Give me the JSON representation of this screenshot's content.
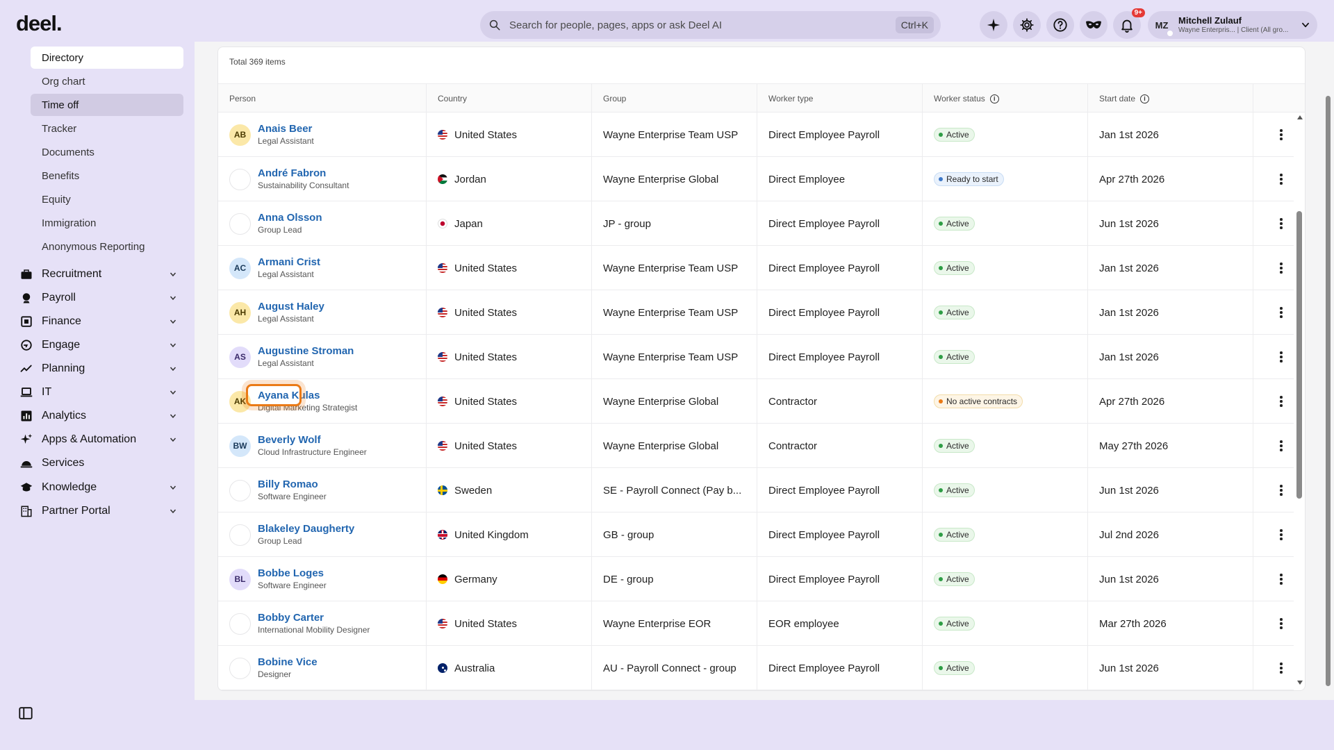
{
  "app": {
    "logo": "deel."
  },
  "search": {
    "placeholder": "Search for people, pages, apps or ask Deel AI",
    "shortcut": "Ctrl+K"
  },
  "notifications": {
    "badge": "9+"
  },
  "user": {
    "initials": "MZ",
    "name": "Mitchell Zulauf",
    "subtitle": "Wayne Enterpris... | Client (All gro..."
  },
  "sidebar": {
    "sub_items": [
      "Directory",
      "Org chart",
      "Time off",
      "Tracker",
      "Documents",
      "Benefits",
      "Equity",
      "Immigration",
      "Anonymous Reporting"
    ],
    "sections": [
      {
        "label": "Recruitment",
        "icon": "briefcase-icon",
        "expandable": true
      },
      {
        "label": "Payroll",
        "icon": "payroll-icon",
        "expandable": true
      },
      {
        "label": "Finance",
        "icon": "finance-icon",
        "expandable": true
      },
      {
        "label": "Engage",
        "icon": "engage-icon",
        "expandable": true
      },
      {
        "label": "Planning",
        "icon": "trend-icon",
        "expandable": true
      },
      {
        "label": "IT",
        "icon": "laptop-icon",
        "expandable": true
      },
      {
        "label": "Analytics",
        "icon": "chart-icon",
        "expandable": true
      },
      {
        "label": "Apps & Automation",
        "icon": "sparkle-icon",
        "expandable": true
      },
      {
        "label": "Services",
        "icon": "cloche-icon",
        "expandable": false
      },
      {
        "label": "Knowledge",
        "icon": "graduation-cap-icon",
        "expandable": true
      },
      {
        "label": "Partner Portal",
        "icon": "building-icon",
        "expandable": true
      }
    ]
  },
  "table": {
    "total": "Total 369 items",
    "columns": [
      "Person",
      "Country",
      "Group",
      "Worker type",
      "Worker status",
      "Start date"
    ],
    "rows": [
      {
        "initials": "AB",
        "avatar": "yellow",
        "name": "Anais Beer",
        "role": "Legal Assistant",
        "flag": "us",
        "country": "United States",
        "group": "Wayne Enterprise Team USP",
        "worker_type": "Direct Employee Payroll",
        "status": "Active",
        "status_kind": "active",
        "start": "Jan 1st 2026"
      },
      {
        "initials": "",
        "avatar": "empty",
        "name": "André Fabron",
        "role": "Sustainability Consultant",
        "flag": "jo",
        "country": "Jordan",
        "group": "Wayne Enterprise Global",
        "worker_type": "Direct Employee",
        "status": "Ready to start",
        "status_kind": "ready",
        "start": "Apr 27th 2026"
      },
      {
        "initials": "",
        "avatar": "empty",
        "name": "Anna Olsson",
        "role": "Group Lead",
        "flag": "jp",
        "country": "Japan",
        "group": "JP - group",
        "worker_type": "Direct Employee Payroll",
        "status": "Active",
        "status_kind": "active",
        "start": "Jun 1st 2026"
      },
      {
        "initials": "AC",
        "avatar": "blue",
        "name": "Armani Crist",
        "role": "Legal Assistant",
        "flag": "us",
        "country": "United States",
        "group": "Wayne Enterprise Team USP",
        "worker_type": "Direct Employee Payroll",
        "status": "Active",
        "status_kind": "active",
        "start": "Jan 1st 2026"
      },
      {
        "initials": "AH",
        "avatar": "yellow",
        "name": "August Haley",
        "role": "Legal Assistant",
        "flag": "us",
        "country": "United States",
        "group": "Wayne Enterprise Team USP",
        "worker_type": "Direct Employee Payroll",
        "status": "Active",
        "status_kind": "active",
        "start": "Jan 1st 2026"
      },
      {
        "initials": "AS",
        "avatar": "purple",
        "name": "Augustine Stroman",
        "role": "Legal Assistant",
        "flag": "us",
        "country": "United States",
        "group": "Wayne Enterprise Team USP",
        "worker_type": "Direct Employee Payroll",
        "status": "Active",
        "status_kind": "active",
        "start": "Jan 1st 2026"
      },
      {
        "initials": "AK",
        "avatar": "yellow",
        "name": "Ayana Kulas",
        "role": "Digital Marketing Strategist",
        "flag": "us",
        "country": "United States",
        "group": "Wayne Enterprise Global",
        "worker_type": "Contractor",
        "status": "No active contracts",
        "status_kind": "none",
        "start": "Apr 27th 2026",
        "highlighted": true
      },
      {
        "initials": "BW",
        "avatar": "blue",
        "name": "Beverly Wolf",
        "role": "Cloud Infrastructure Engineer",
        "flag": "us",
        "country": "United States",
        "group": "Wayne Enterprise Global",
        "worker_type": "Contractor",
        "status": "Active",
        "status_kind": "active",
        "start": "May 27th 2026"
      },
      {
        "initials": "",
        "avatar": "empty",
        "name": "Billy Romao",
        "role": "Software Engineer",
        "flag": "se",
        "country": "Sweden",
        "group": "SE - Payroll Connect (Pay b...",
        "worker_type": "Direct Employee Payroll",
        "status": "Active",
        "status_kind": "active",
        "start": "Jun 1st 2026"
      },
      {
        "initials": "",
        "avatar": "empty",
        "name": "Blakeley Daugherty",
        "role": "Group Lead",
        "flag": "gb",
        "country": "United Kingdom",
        "group": "GB - group",
        "worker_type": "Direct Employee Payroll",
        "status": "Active",
        "status_kind": "active",
        "start": "Jul 2nd 2026"
      },
      {
        "initials": "BL",
        "avatar": "purple",
        "name": "Bobbe Loges",
        "role": "Software Engineer",
        "flag": "de",
        "country": "Germany",
        "group": "DE - group",
        "worker_type": "Direct Employee Payroll",
        "status": "Active",
        "status_kind": "active",
        "start": "Jun 1st 2026"
      },
      {
        "initials": "",
        "avatar": "empty",
        "name": "Bobby Carter",
        "role": "International Mobility Designer",
        "flag": "us",
        "country": "United States",
        "group": "Wayne Enterprise EOR",
        "worker_type": "EOR employee",
        "status": "Active",
        "status_kind": "active",
        "start": "Mar 27th 2026"
      },
      {
        "initials": "",
        "avatar": "empty",
        "name": "Bobine Vice",
        "role": "Designer",
        "flag": "au",
        "country": "Australia",
        "group": "AU - Payroll Connect - group",
        "worker_type": "Direct Employee Payroll",
        "status": "Active",
        "status_kind": "active",
        "start": "Jun 1st 2026"
      }
    ]
  }
}
